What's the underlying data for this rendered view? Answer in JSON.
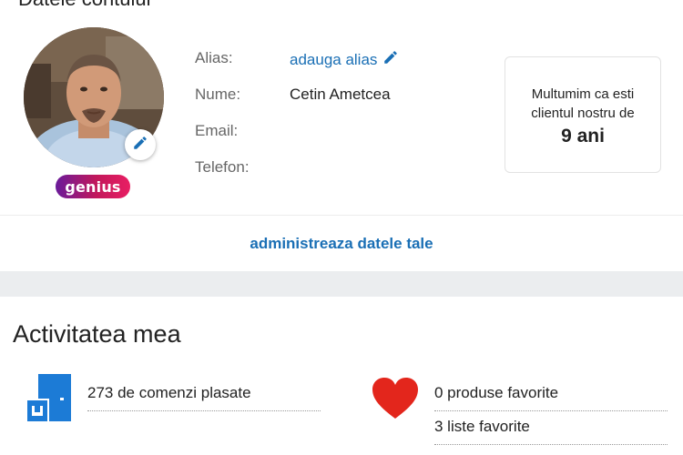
{
  "profile": {
    "header_title": "Datele contului",
    "avatar_alt": "profile photo",
    "badge": "genius",
    "fields": [
      {
        "label": "Alias:",
        "value": "adauga alias"
      },
      {
        "label": "Nume:",
        "value": "Cetin Ametcea"
      },
      {
        "label": "Email:",
        "value": ""
      },
      {
        "label": "Telefon:",
        "value": ""
      }
    ]
  },
  "loyalty": {
    "line1": "Multumim ca esti",
    "line2": "clientul nostru de",
    "years": "9 ani"
  },
  "manage_link": "administreaza datele tale",
  "activity": {
    "title": "Activitatea mea",
    "orders": "273 de comenzi plasate",
    "favorites": "0 produse favorite",
    "lists": "3 liste favorite"
  },
  "colors": {
    "link": "#1a6fb5",
    "heart": "#e3261c",
    "orders_icon": "#1c7bd6",
    "band": "#ebedef"
  },
  "icons": {
    "edit": "pencil-icon",
    "orders": "door-box-icon",
    "favorites": "heart-icon"
  }
}
